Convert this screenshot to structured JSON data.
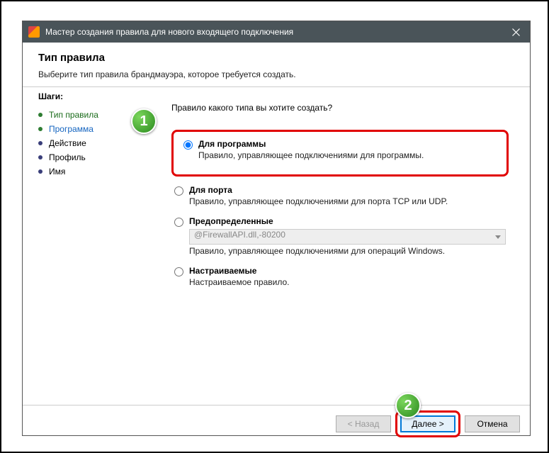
{
  "window": {
    "title": "Мастер создания правила для нового входящего подключения"
  },
  "header": {
    "title": "Тип правила",
    "subtitle": "Выберите тип правила брандмауэра, которое требуется создать."
  },
  "sidebar": {
    "title": "Шаги:",
    "steps": [
      {
        "label": "Тип правила"
      },
      {
        "label": "Программа"
      },
      {
        "label": "Действие"
      },
      {
        "label": "Профиль"
      },
      {
        "label": "Имя"
      }
    ]
  },
  "content": {
    "prompt": "Правило какого типа вы хотите создать?",
    "options": [
      {
        "title": "Для программы",
        "desc": "Правило, управляющее подключениями для программы."
      },
      {
        "title": "Для порта",
        "desc": "Правило, управляющее подключениями для порта TCP или UDP."
      },
      {
        "title": "Предопределенные",
        "combo": "@FirewallAPI.dll,-80200",
        "desc": "Правило, управляющее подключениями для операций Windows."
      },
      {
        "title": "Настраиваемые",
        "desc": "Настраиваемое правило."
      }
    ]
  },
  "footer": {
    "back": "< Назад",
    "next": "Далее >",
    "cancel": "Отмена"
  },
  "callouts": {
    "one": "1",
    "two": "2"
  }
}
